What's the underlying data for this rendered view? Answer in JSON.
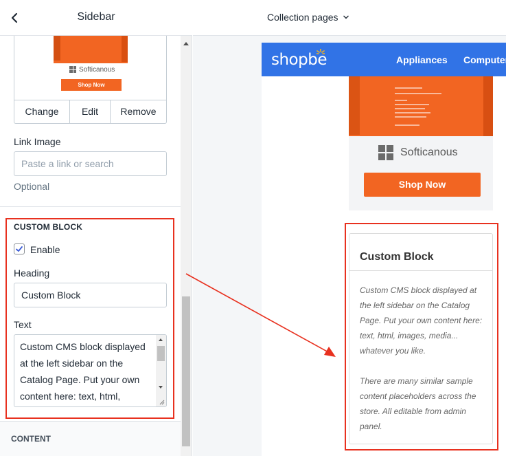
{
  "sidebar": {
    "title": "Sidebar",
    "image_preview": {
      "logo_text": "Softicanous",
      "shop_button": "Shop Now"
    },
    "image_buttons": {
      "change": "Change",
      "edit": "Edit",
      "remove": "Remove"
    },
    "link_image": {
      "label": "Link Image",
      "placeholder": "Paste a link or search",
      "hint": "Optional"
    },
    "custom_block": {
      "section_title": "CUSTOM BLOCK",
      "enable_label": "Enable",
      "enabled": true,
      "heading_label": "Heading",
      "heading_value": "Custom Block",
      "text_label": "Text",
      "text_lines": [
        "Custom CMS block displayed",
        "at the left sidebar on the",
        "Catalog Page. Put your own",
        "content here: text, html,"
      ]
    },
    "content_section_title": "CONTENT"
  },
  "preview": {
    "page_selector": "Collection pages",
    "store": {
      "brand": "shopbe",
      "nav_items": [
        "Appliances",
        "Computer"
      ],
      "banner": {
        "logo_text": "Softicanous",
        "shop_button": "Shop Now"
      },
      "custom_block": {
        "heading": "Custom Block",
        "paragraph1": "Custom CMS block displayed at the left sidebar on the Catalog Page. Put your own content here: text, html, images, media... whatever you like.",
        "paragraph2": "There are many similar sample content placeholders across the store. All editable from admin panel."
      }
    }
  },
  "colors": {
    "accent_blue": "#3173e6",
    "brand_orange": "#f26522",
    "annotation_red": "#e8311f"
  }
}
